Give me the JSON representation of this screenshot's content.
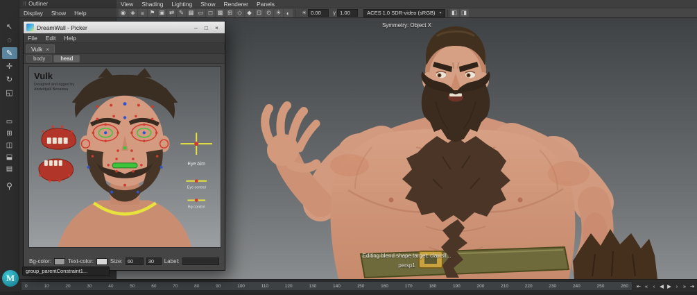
{
  "app": {
    "logo_letter": "M"
  },
  "toolbox": {
    "tools": [
      {
        "name": "select-tool-icon",
        "glyph": "↖"
      },
      {
        "name": "lasso-tool-icon",
        "glyph": "◌"
      },
      {
        "name": "paint-select-tool-icon",
        "glyph": "✎",
        "active": true
      },
      {
        "name": "move-tool-icon",
        "glyph": "✛"
      },
      {
        "name": "rotate-tool-icon",
        "glyph": "↻"
      },
      {
        "name": "scale-tool-icon",
        "glyph": "◱"
      }
    ],
    "layouts": [
      {
        "name": "single-pane-layout-icon",
        "glyph": "▭"
      },
      {
        "name": "four-pane-layout-icon",
        "glyph": "⊞"
      },
      {
        "name": "persp-outliner-layout-icon",
        "glyph": "◫"
      },
      {
        "name": "persp-graph-layout-icon",
        "glyph": "⬓"
      },
      {
        "name": "hypershade-layout-icon",
        "glyph": "▤"
      }
    ],
    "zoom_glyph": "⚲"
  },
  "outliner": {
    "title": "Outliner",
    "menus": [
      {
        "name": "outliner-menu-display",
        "label": "Display"
      },
      {
        "name": "outliner-menu-show",
        "label": "Show"
      },
      {
        "name": "outliner-menu-help",
        "label": "Help"
      }
    ]
  },
  "viewport": {
    "menus": [
      {
        "name": "viewport-menu-view",
        "label": "View"
      },
      {
        "name": "viewport-menu-shading",
        "label": "Shading"
      },
      {
        "name": "viewport-menu-lighting",
        "label": "Lighting"
      },
      {
        "name": "viewport-menu-show",
        "label": "Show"
      },
      {
        "name": "viewport-menu-renderer",
        "label": "Renderer"
      },
      {
        "name": "viewport-menu-panels",
        "label": "Panels"
      }
    ],
    "toolbar_icons": [
      {
        "name": "select-camera-icon",
        "glyph": "◉"
      },
      {
        "name": "lock-camera-icon",
        "glyph": "◈"
      },
      {
        "name": "camera-attributes-icon",
        "glyph": "≡"
      },
      {
        "name": "bookmarks-icon",
        "glyph": "⚑"
      },
      {
        "name": "image-plane-icon",
        "glyph": "▣"
      },
      {
        "name": "pan-zoom-icon",
        "glyph": "⇄"
      },
      {
        "name": "grease-pencil-icon",
        "glyph": "✎"
      },
      {
        "name": "grid-icon",
        "glyph": "▦"
      },
      {
        "name": "film-gate-icon",
        "glyph": "▭"
      },
      {
        "name": "resolution-gate-icon",
        "glyph": "◻"
      },
      {
        "name": "gate-mask-icon",
        "glyph": "▩"
      },
      {
        "name": "field-chart-icon",
        "glyph": "⊞"
      },
      {
        "name": "safe-action-icon",
        "glyph": "◇"
      },
      {
        "name": "safe-title-icon",
        "glyph": "◆"
      },
      {
        "name": "frame-all-icon",
        "glyph": "⊡"
      },
      {
        "name": "frame-selected-icon",
        "glyph": "⊙"
      },
      {
        "name": "lighting-icon",
        "glyph": "☀"
      },
      {
        "name": "shadows-icon",
        "glyph": "◐"
      }
    ],
    "trailing_icons": [
      {
        "name": "wireframe-display-icon",
        "glyph": "◧"
      },
      {
        "name": "shaded-display-icon",
        "glyph": "◨"
      }
    ],
    "exposure_icon": "☀",
    "exposure_value": "0.00",
    "gamma_icon": "γ",
    "gamma_value": "1.00",
    "colorspace": "ACES 1.0 SDR-video (sRGB)",
    "hud": {
      "symmetry": "Symmetry: Object X",
      "status": "Editing blend shape target: clawsil...",
      "camera": "persp1"
    }
  },
  "picker": {
    "title": "DreamWall - Picker",
    "window_buttons": [
      {
        "name": "minimize-button",
        "glyph": "–"
      },
      {
        "name": "maximize-button",
        "glyph": "□"
      },
      {
        "name": "close-button",
        "glyph": "×"
      }
    ],
    "menus": [
      {
        "name": "picker-menu-file",
        "label": "File"
      },
      {
        "name": "picker-menu-edit",
        "label": "Edit"
      },
      {
        "name": "picker-menu-help",
        "label": "Help"
      }
    ],
    "tab_label": "Vulk",
    "tab_close": "×",
    "subtabs": [
      {
        "name": "picker-subtab-body",
        "label": "body"
      },
      {
        "name": "picker-subtab-head",
        "label": "head",
        "active": true
      }
    ],
    "canvas": {
      "character_name": "Vulk",
      "credit_line1": "Designed and rigged by",
      "credit_line2": "Abdeldjalil Benaissa",
      "eye_aim_label": "Eye Aim",
      "eye_control_label": "Eye control",
      "bg_control_label": "Bg control"
    },
    "footer": {
      "bg_color_label": "Bg-color:",
      "text_color_label": "Text-color:",
      "size_label": "Size:",
      "size_value": "60",
      "size_value_2": "30",
      "label_label": "Label:",
      "label_value": ""
    }
  },
  "helpline": {
    "value": "group_parentConstraint1..."
  },
  "timeline": {
    "ticks": [
      "0",
      "10",
      "20",
      "30",
      "40",
      "50",
      "60",
      "70",
      "80",
      "90",
      "100",
      "110",
      "120",
      "130",
      "140",
      "150",
      "160",
      "170",
      "180",
      "190",
      "200",
      "210",
      "220",
      "230",
      "240",
      "250",
      "260"
    ],
    "playback": [
      {
        "name": "go-to-start-button",
        "glyph": "⇤"
      },
      {
        "name": "step-back-key-button",
        "glyph": "«"
      },
      {
        "name": "step-back-frame-button",
        "glyph": "‹"
      },
      {
        "name": "play-backwards-button",
        "glyph": "◀"
      },
      {
        "name": "play-forwards-button",
        "glyph": "▶"
      },
      {
        "name": "step-forward-frame-button",
        "glyph": "›"
      },
      {
        "name": "step-forward-key-button",
        "glyph": "»"
      },
      {
        "name": "go-to-end-button",
        "glyph": "⇥"
      }
    ]
  },
  "colors": {
    "accent": "#5b87a0",
    "skin": "#d09a80",
    "hair": "#42301f",
    "control_red": "#cf3b2e",
    "control_green": "#3ec43c",
    "control_yellow": "#e8e33c"
  }
}
